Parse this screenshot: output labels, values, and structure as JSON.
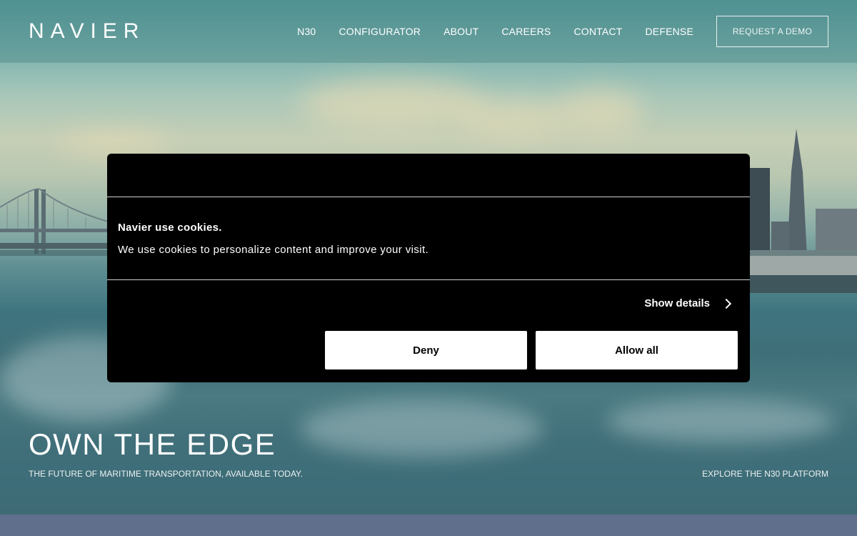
{
  "header": {
    "logo": "NAVIER",
    "nav": [
      "N30",
      "CONFIGURATOR",
      "ABOUT",
      "CAREERS",
      "CONTACT",
      "DEFENSE"
    ],
    "demo_button": "REQUEST A DEMO"
  },
  "hero": {
    "title": "OWN THE EDGE",
    "subtitle": "THE FUTURE OF MARITIME TRANSPORTATION, AVAILABLE TODAY.",
    "explore_link": "EXPLORE THE N30 PLATFORM"
  },
  "cookie": {
    "heading": "Navier use cookies.",
    "text": "We use cookies to personalize content and improve your visit.",
    "show_details": "Show details",
    "deny": "Deny",
    "allow_all": "Allow all"
  },
  "icons": {
    "show_details": "chevron-right-icon"
  }
}
